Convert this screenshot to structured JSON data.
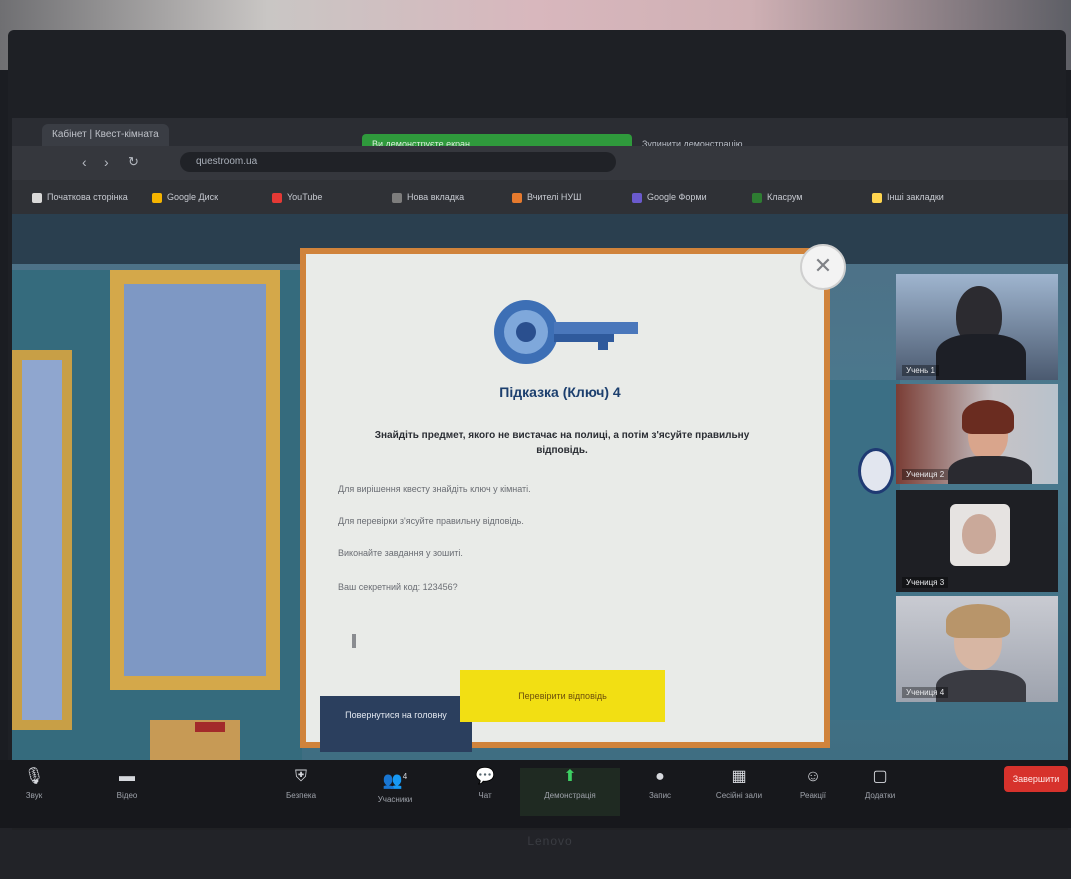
{
  "browser": {
    "tab_title": "Кабінет | Квест-кімната",
    "url": "questroom.ua",
    "sharing_banner": "Ви демонструєте екран",
    "sharing_stop": "Зупинити демонстрацію",
    "bookmarks": [
      {
        "label": "Початкова сторінка",
        "color": "#d9d9d9"
      },
      {
        "label": "Google Диск",
        "color": "#f5b400"
      },
      {
        "label": "YouTube",
        "color": "#e53935"
      },
      {
        "label": "Нова вкладка",
        "color": "#7d7d7d"
      },
      {
        "label": "Вчителі НУШ",
        "color": "#e67a2e"
      },
      {
        "label": "Google Форми",
        "color": "#6a5acd"
      },
      {
        "label": "Класрум",
        "color": "#2e7d32"
      },
      {
        "label": "Інші закладки",
        "color": "#ffd54f"
      }
    ]
  },
  "dialog": {
    "title": "Підказка (Ключ) 4",
    "intro": "Знайдіть предмет, якого не вистачає на полиці, а потім з'ясуйте правильну відповідь.",
    "hints": [
      "Для вирішення квесту знайдіть ключ у кімнаті.",
      "Для перевірки з'ясуйте правильну відповідь.",
      "Виконайте завдання у зошиті.",
      "Ваш секретний код: 123456?"
    ],
    "main_menu_button": "Повернутися на головну",
    "check_button": "Перевірити відповідь",
    "close_icon": "✕"
  },
  "participants": [
    {
      "name": "Учень 1"
    },
    {
      "name": "Учениця 2"
    },
    {
      "name": "Учениця 3"
    },
    {
      "name": "Учениця 4"
    }
  ],
  "toolbar": {
    "mute": "Звук",
    "video": "Відео",
    "security": "Безпека",
    "participants": "Учасники",
    "participants_count": "4",
    "chat": "Чат",
    "share": "Демонстрація",
    "record": "Запис",
    "breakout": "Сесійні зали",
    "reactions": "Реакції",
    "apps": "Додатки",
    "end": "Завершити"
  },
  "monitor_brand": "Lenovo"
}
